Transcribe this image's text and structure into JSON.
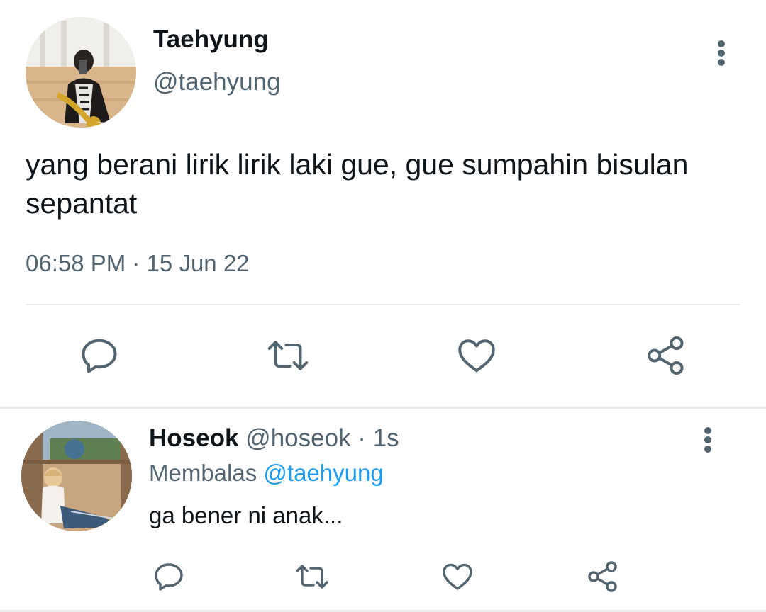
{
  "main_tweet": {
    "author_name": "Taehyung",
    "author_handle": "@taehyung",
    "text": "yang berani lirik lirik laki gue, gue sumpahin bisulan sepantat",
    "timestamp": "06:58 PM · 15 Jun 22",
    "avatar_icon": "profile-photo",
    "more_icon": "more-vertical-icon",
    "actions": [
      "reply-icon",
      "retweet-icon",
      "like-icon",
      "share-icon"
    ]
  },
  "reply_tweet": {
    "author_name": "Hoseok",
    "author_handle": "@hoseok",
    "separator": " · ",
    "time_ago": "1s",
    "replying_prefix": "Membalas",
    "replying_to": "@taehyung",
    "text": "ga bener ni anak...",
    "avatar_icon": "profile-photo",
    "more_icon": "more-vertical-icon",
    "actions": [
      "reply-icon",
      "retweet-icon",
      "like-icon",
      "share-icon"
    ]
  },
  "colors": {
    "primary_text": "#0f1419",
    "secondary_text": "#536471",
    "link": "#1d9bf0",
    "divider": "#e7e9ec",
    "background": "#ffffff"
  }
}
